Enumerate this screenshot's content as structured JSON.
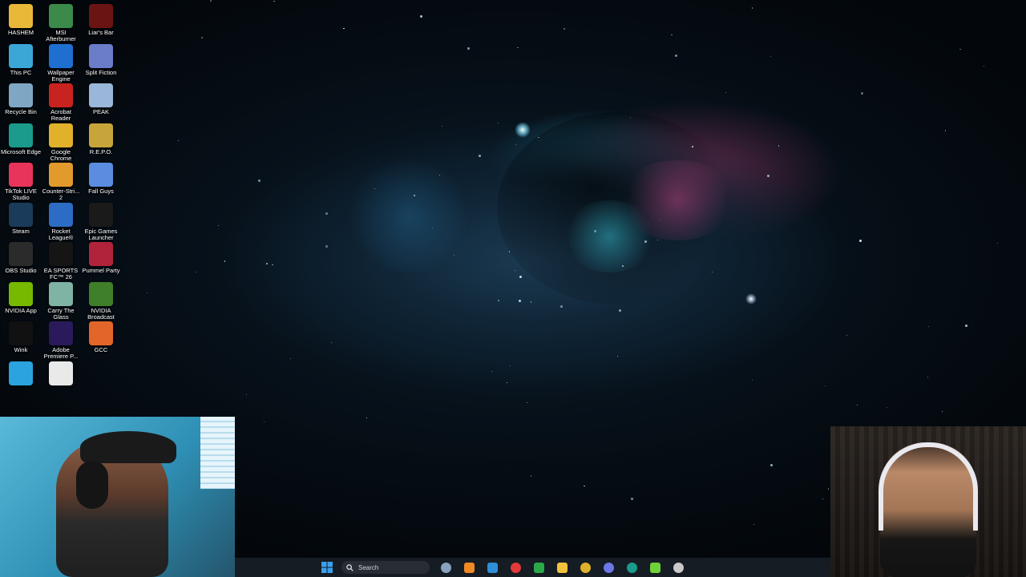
{
  "desktop": {
    "wallpaper": "space-nebula",
    "icons": [
      {
        "label": "HASHEM",
        "icon": "folder-icon",
        "color": "#e9b838"
      },
      {
        "label": "MSI Afterburner",
        "icon": "msi-afterburner-icon",
        "color": "#3b8a4a"
      },
      {
        "label": "Liar's Bar",
        "icon": "liars-bar-icon",
        "color": "#6b1414"
      },
      {
        "label": "This PC",
        "icon": "this-pc-icon",
        "color": "#3aa7d6"
      },
      {
        "label": "Wallpaper Engine",
        "icon": "wallpaper-engine-icon",
        "color": "#1f6fd1"
      },
      {
        "label": "Split Fiction",
        "icon": "split-fiction-icon",
        "color": "#6b7cc9"
      },
      {
        "label": "Recycle Bin",
        "icon": "recycle-bin-icon",
        "color": "#7fa7c4"
      },
      {
        "label": "Acrobat Reader",
        "icon": "acrobat-reader-icon",
        "color": "#c8231f"
      },
      {
        "label": "PEAK",
        "icon": "peak-icon",
        "color": "#9ab6d8"
      },
      {
        "label": "Microsoft Edge",
        "icon": "edge-icon",
        "color": "#1a9b8c"
      },
      {
        "label": "Google Chrome",
        "icon": "chrome-icon",
        "color": "#e0b12b"
      },
      {
        "label": "R.E.P.O.",
        "icon": "repo-icon",
        "color": "#c7a53a"
      },
      {
        "label": "TikTok LIVE Studio",
        "icon": "tiktok-live-icon",
        "color": "#e8345a"
      },
      {
        "label": "Counter-Stri... 2",
        "icon": "counter-strike-icon",
        "color": "#e39a2c"
      },
      {
        "label": "Fall Guys",
        "icon": "fall-guys-icon",
        "color": "#5a8de0"
      },
      {
        "label": "Steam",
        "icon": "steam-icon",
        "color": "#1b3b5a"
      },
      {
        "label": "Rocket League®",
        "icon": "rocket-league-icon",
        "color": "#2d6cc4"
      },
      {
        "label": "Epic Games Launcher",
        "icon": "epic-games-icon",
        "color": "#1a1a1a"
      },
      {
        "label": "OBS Studio",
        "icon": "obs-icon",
        "color": "#2b2b2b"
      },
      {
        "label": "EA SPORTS FC™ 26",
        "icon": "ea-fc-icon",
        "color": "#151515"
      },
      {
        "label": "Pummel Party",
        "icon": "pummel-party-icon",
        "color": "#b0233a"
      },
      {
        "label": "NVIDIA App",
        "icon": "nvidia-app-icon",
        "color": "#76b900"
      },
      {
        "label": "Carry The Glass",
        "icon": "carry-the-glass-icon",
        "color": "#7fb3a4"
      },
      {
        "label": "NVIDIA Broadcast",
        "icon": "nvidia-broadcast-icon",
        "color": "#3f7f2a"
      },
      {
        "label": "Wink",
        "icon": "wink-icon",
        "color": "#111111"
      },
      {
        "label": "Adobe Premiere P...",
        "icon": "premiere-icon",
        "color": "#2a1a5c"
      },
      {
        "label": "GCC",
        "icon": "gcc-icon",
        "color": "#e2662a"
      },
      {
        "label": "",
        "icon": "telegram-icon",
        "color": "#2aa3de"
      },
      {
        "label": "",
        "icon": "document-icon",
        "color": "#e9e9e9"
      }
    ]
  },
  "taskbar": {
    "search_label": "Search",
    "apps": [
      {
        "icon": "settings-icon",
        "color": "#8aa4bf"
      },
      {
        "icon": "cloud-icon",
        "color": "#f08a24"
      },
      {
        "icon": "photos-icon",
        "color": "#2f8fd8"
      },
      {
        "icon": "app-red-icon",
        "color": "#e23a3a"
      },
      {
        "icon": "xbox-icon",
        "color": "#2ba84a"
      },
      {
        "icon": "file-explorer-icon",
        "color": "#f2c23a"
      },
      {
        "icon": "chrome-icon",
        "color": "#e0b12b"
      },
      {
        "icon": "discord-icon",
        "color": "#6c78e8"
      },
      {
        "icon": "edge-icon",
        "color": "#1a9b8c"
      },
      {
        "icon": "media-player-icon",
        "color": "#6fd13a"
      },
      {
        "icon": "app-gear-icon",
        "color": "#c9c9c9"
      }
    ]
  },
  "overlays": {
    "webcam_left": "streamer-webcam",
    "webcam_right": "guest-webcam"
  }
}
